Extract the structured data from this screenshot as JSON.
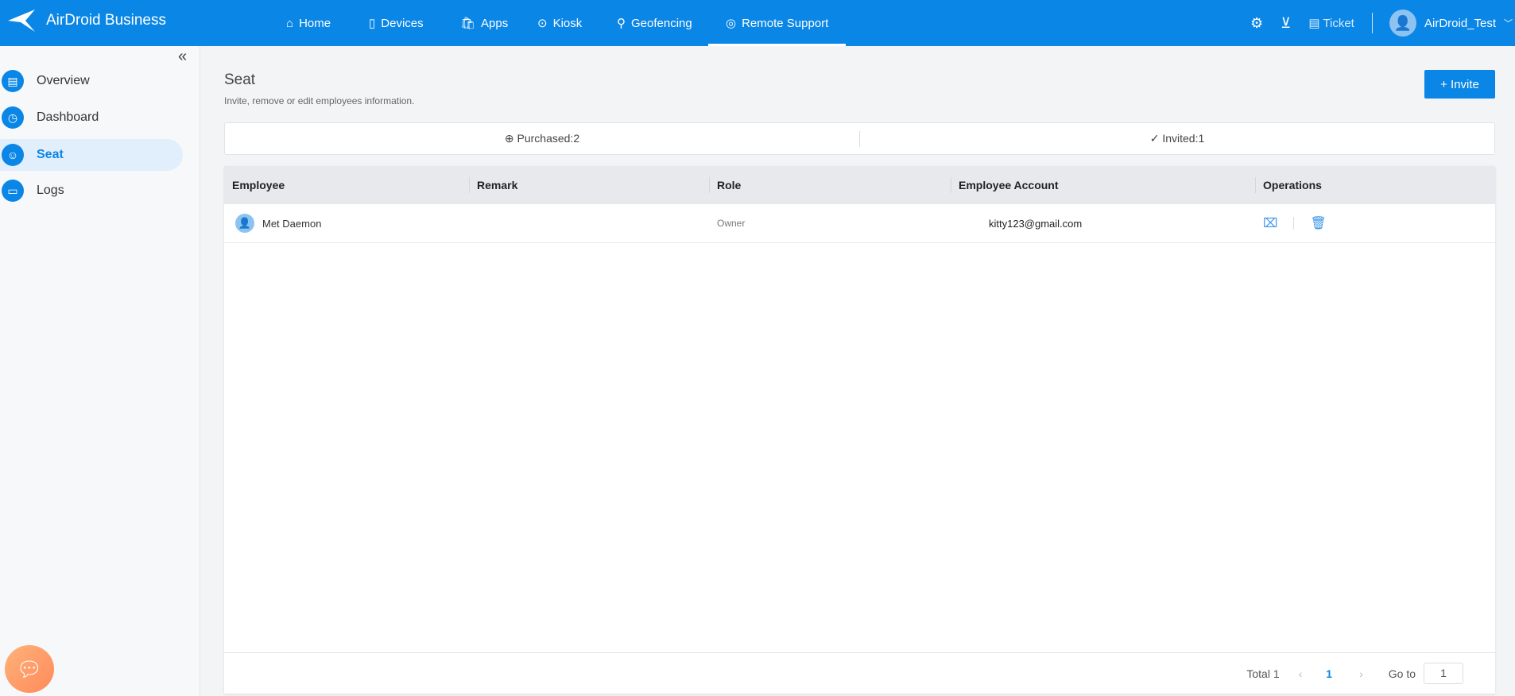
{
  "app": {
    "title": "AirDroid Business"
  },
  "nav": [
    {
      "label": "Home",
      "icon": "home-icon"
    },
    {
      "label": "Devices",
      "icon": "device-icon"
    },
    {
      "label": "Apps",
      "icon": "apps-icon"
    },
    {
      "label": "Kiosk",
      "icon": "kiosk-icon"
    },
    {
      "label": "Geofencing",
      "icon": "geofencing-icon"
    },
    {
      "label": "Remote Support",
      "icon": "lifebuoy-icon",
      "active": true
    }
  ],
  "header_right": {
    "ticket": "Ticket",
    "user": "AirDroid_Test"
  },
  "sidebar": [
    {
      "label": "Overview"
    },
    {
      "label": "Dashboard"
    },
    {
      "label": "Seat",
      "active": true
    },
    {
      "label": "Logs"
    }
  ],
  "page": {
    "title": "Seat",
    "subtitle": "Invite, remove or edit employees information.",
    "invite_label": "+ Invite"
  },
  "stats": {
    "purchased": "Purchased:2",
    "invited": "Invited:1"
  },
  "table": {
    "headers": [
      "Employee",
      "Remark",
      "Role",
      "Employee Account",
      "Operations"
    ],
    "rows": [
      {
        "employee": "Met Daemon",
        "remark": "",
        "role": "Owner",
        "account": "kitty123@gmail.com"
      }
    ]
  },
  "pagination": {
    "total": "Total 1",
    "current": "1",
    "goto_label": "Go to",
    "goto_value": "1"
  },
  "colors": {
    "brand": "#0a86e6"
  }
}
